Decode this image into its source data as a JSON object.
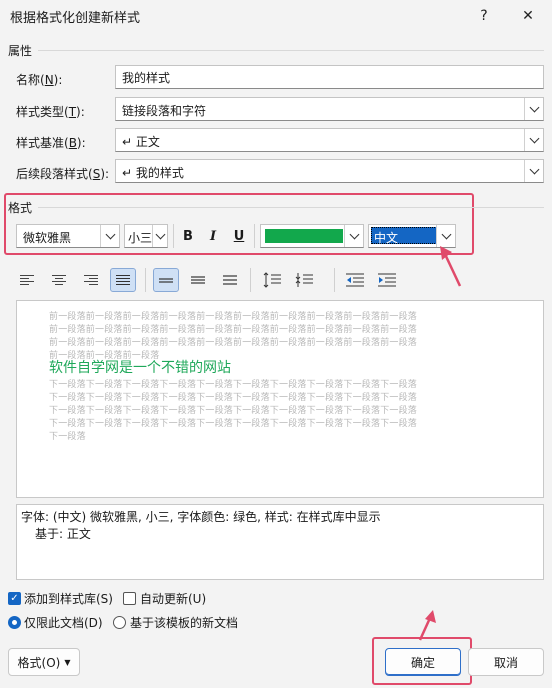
{
  "window": {
    "title": "根据格式化创建新样式",
    "help": "?",
    "close": "✕"
  },
  "properties": {
    "section": "属性",
    "name_label": "名称(",
    "name_key": "N",
    "name_label_end": "):",
    "name_value": "我的样式",
    "type_label": "样式类型(",
    "type_key": "T",
    "type_label_end": "):",
    "type_value": "链接段落和字符",
    "based_label": "样式基准(",
    "based_key": "B",
    "based_label_end": "):",
    "based_value": "↵ 正文",
    "next_label": "后续段落样式(",
    "next_key": "S",
    "next_label_end": "):",
    "next_value": "↵ 我的样式"
  },
  "format": {
    "section": "格式",
    "font": "微软雅黑",
    "size": "小三",
    "bold": "B",
    "italic": "I",
    "underline": "U",
    "color": "#12a84c",
    "script": "中文"
  },
  "preview": {
    "prev_lines": [
      "前一段落前一段落前一段落前一段落前一段落前一段落前一段落前一段落前一段落前一段落",
      "前一段落前一段落前一段落前一段落前一段落前一段落前一段落前一段落前一段落前一段落",
      "前一段落前一段落前一段落前一段落前一段落前一段落前一段落前一段落前一段落前一段落",
      "前一段落前一段落前一段落"
    ],
    "sample": "软件自学网是一个不错的网站",
    "next_lines": [
      "下一段落下一段落下一段落下一段落下一段落下一段落下一段落下一段落下一段落下一段落",
      "下一段落下一段落下一段落下一段落下一段落下一段落下一段落下一段落下一段落下一段落",
      "下一段落下一段落下一段落下一段落下一段落下一段落下一段落下一段落下一段落下一段落",
      "下一段落下一段落下一段落下一段落下一段落下一段落下一段落下一段落下一段落下一段落",
      "下一段落"
    ]
  },
  "description": {
    "line1": "字体: (中文) 微软雅黑, 小三, 字体颜色: 绿色, 样式: 在样式库中显示",
    "line2": "基于: 正文"
  },
  "options": {
    "add_to_gallery": "添加到样式库(S)",
    "auto_update": "自动更新(U)",
    "only_this_doc": "仅限此文档(D)",
    "new_docs": "基于该模板的新文档"
  },
  "buttons": {
    "format": "格式(O)",
    "ok": "确定",
    "cancel": "取消"
  },
  "colors": {
    "accent": "#1466c4",
    "highlight": "#e04a6a",
    "sample_text": "#1fa85a"
  }
}
